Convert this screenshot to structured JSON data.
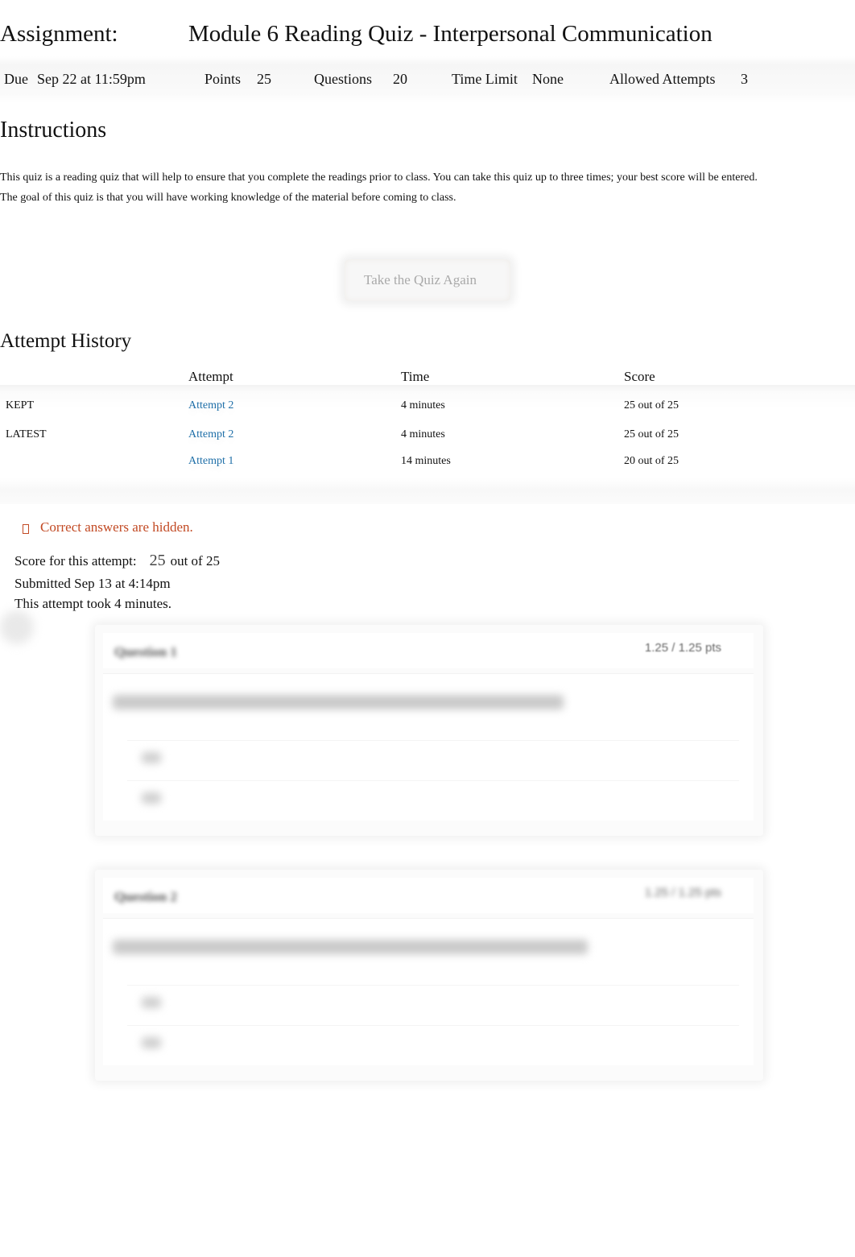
{
  "assignment": {
    "label": "Assignment:",
    "title": "Module 6 Reading Quiz - Interpersonal Communication"
  },
  "meta": {
    "due_label": "Due",
    "due_value": "Sep 22 at 11:59pm",
    "points_label": "Points",
    "points_value": "25",
    "questions_label": "Questions",
    "questions_value": "20",
    "time_limit_label": "Time Limit",
    "time_limit_value": "None",
    "allowed_attempts_label": "Allowed Attempts",
    "allowed_attempts_value": "3"
  },
  "instructions": {
    "heading": "Instructions",
    "lines": [
      "This quiz is a reading quiz that will help to ensure that you complete the readings prior to class. You can take this quiz up to three times; your best score will be entered.",
      "The goal of this quiz is that you will have working knowledge of the material before coming to class."
    ]
  },
  "take_again_button": "Take the Quiz Again",
  "attempt_history": {
    "heading": "Attempt History",
    "columns": [
      "",
      "Attempt",
      "Time",
      "Score"
    ],
    "rows": [
      {
        "tag": "KEPT",
        "attempt": "Attempt 2",
        "time": "4 minutes",
        "score": "25 out of 25"
      },
      {
        "tag": "LATEST",
        "attempt": "Attempt 2",
        "time": "4 minutes",
        "score": "25 out of 25"
      },
      {
        "tag": "",
        "attempt": "Attempt 1",
        "time": "14 minutes",
        "score": "20 out of 25"
      }
    ]
  },
  "attempt_summary": {
    "hidden_notice": "Correct answers are hidden.",
    "score_label": "Score for this attempt:",
    "score_value": "25",
    "score_total": "out of 25",
    "submitted": "Submitted Sep 13 at 4:14pm",
    "duration": "This attempt took 4 minutes."
  },
  "questions": [
    {
      "title": "Question 1",
      "points": "1.25 / 1.25 pts"
    },
    {
      "title": "Question 2",
      "points": "1.25 / 1.25 pts"
    }
  ]
}
